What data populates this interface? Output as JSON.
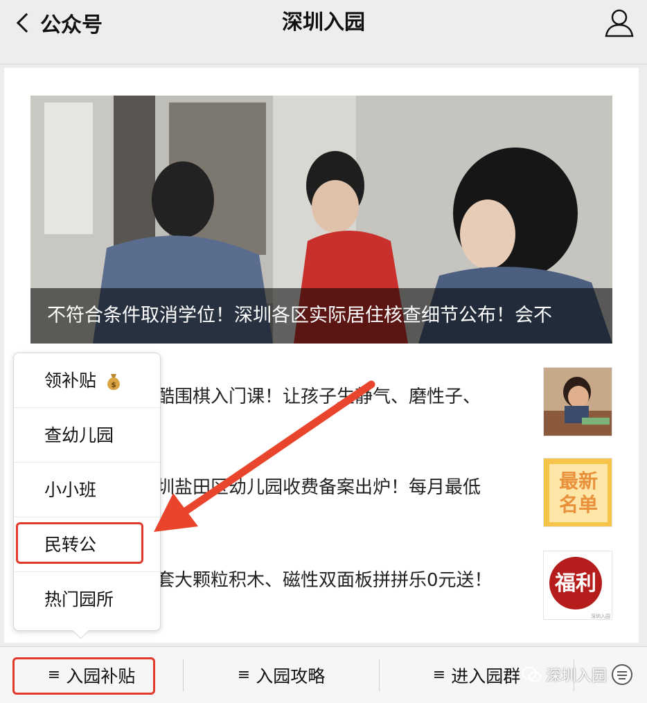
{
  "nav": {
    "back_label": "公众号",
    "title": "深圳入园"
  },
  "hero": {
    "caption": "不符合条件取消学位！深圳各区实际居住核查细节公布！会不"
  },
  "articles": [
    {
      "text": "酷围棋入门课！让孩子生静气、磨性子、"
    },
    {
      "text": "圳盐田区幼儿园收费备案出炉！每月最低"
    },
    {
      "text": "套大颗粒积木、磁性双面板拼拼乐0元送！"
    }
  ],
  "thumbs": {
    "second_line1": "最新",
    "second_line2": "名单",
    "third": "福利",
    "third_small": "深圳入园"
  },
  "popup": {
    "items": [
      {
        "label": "领补贴",
        "icon": "money-bag-icon"
      },
      {
        "label": "查幼儿园"
      },
      {
        "label": "小小班"
      },
      {
        "label": "民转公"
      },
      {
        "label": "热门园所"
      }
    ]
  },
  "bottom_tabs": [
    {
      "label": "入园补贴",
      "menu_glyph": "≡"
    },
    {
      "label": "入园攻略",
      "menu_glyph": "≡"
    },
    {
      "label": "进入园群",
      "menu_glyph": "≡"
    }
  ],
  "watermark": "深圳入园",
  "colors": {
    "highlight": "#e0392b",
    "arrow": "#e8452c"
  }
}
